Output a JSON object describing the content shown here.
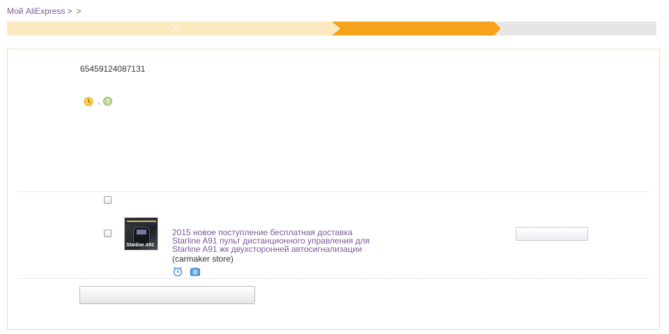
{
  "breadcrumb": {
    "items": [
      "Мой AliExpress",
      "",
      ""
    ],
    "separator": ">"
  },
  "steps": [
    {
      "label": "",
      "state": "done"
    },
    {
      "label": "",
      "state": "done"
    },
    {
      "label": "",
      "state": "active"
    },
    {
      "label": "",
      "state": "todo"
    }
  ],
  "order": {
    "number_label": "",
    "number": "65459124087131",
    "status_label": "",
    "status": "",
    "reminder_label": "",
    "reminder_text": "",
    "countdown": ""
  },
  "notes": {
    "line1": "",
    "line2": "",
    "line3_before": "",
    "line3_link": "",
    "line3_after": ""
  },
  "table": {
    "headers": {
      "select_all": "",
      "description": "",
      "status": "",
      "actions": ""
    },
    "rows": [
      {
        "thumb_caption": "Starline A91",
        "title": "2015 новое поступление бесплатная доставка Starline A91 пульт дистанционного управления для Starline A91 жк двухсторонней автосигнализации",
        "store": "(carmaker store)",
        "status": "",
        "action_label": ""
      }
    ]
  },
  "confirm_button": "",
  "icons": {
    "clock": "clock-icon",
    "help": "help-icon",
    "alarm": "alarm-clock-icon",
    "camera": "camera-icon"
  },
  "colors": {
    "step_active": "#f6a21c",
    "step_done": "#fde9c0",
    "step_todo": "#e6e6e6",
    "status_green": "#2e8b1e",
    "countdown_orange": "#e36c0a",
    "link_blue": "#3a6ea5",
    "product_link": "#7a5a9a"
  }
}
